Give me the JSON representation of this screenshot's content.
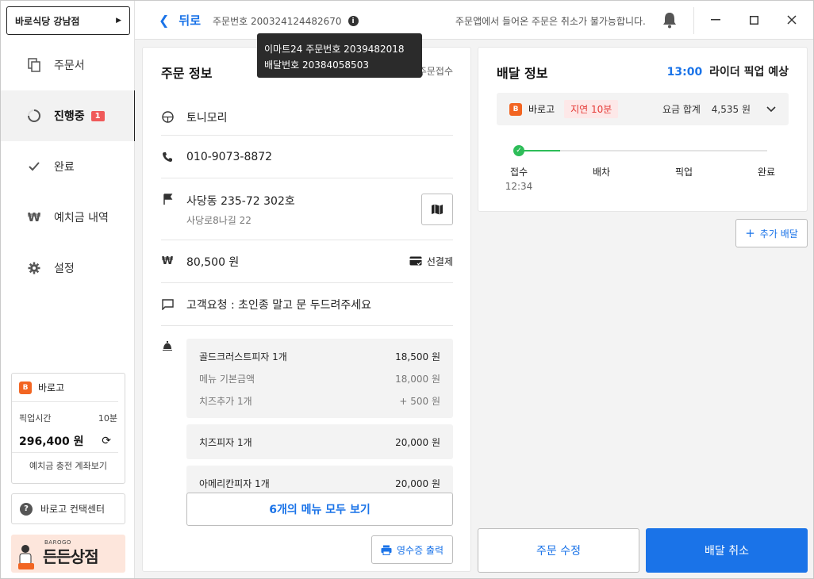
{
  "sidebar": {
    "store_name": "바로식당 강남점",
    "nav": [
      {
        "label": "주문서",
        "icon": "copy-icon"
      },
      {
        "label": "진행중",
        "icon": "progress-icon",
        "badge": "1",
        "active": true
      },
      {
        "label": "완료",
        "icon": "check-icon"
      },
      {
        "label": "예치금 내역",
        "icon": "won-icon"
      },
      {
        "label": "설정",
        "icon": "gear-icon"
      }
    ],
    "barogo_card": {
      "brand": "바로고",
      "pickup_label": "픽업시간",
      "pickup_value": "10분",
      "balance": "296,400 원",
      "link": "예치금 충전 계좌보기"
    },
    "contact_center": "바로고 컨택센터",
    "banner": {
      "tag": "BAROGO",
      "title": "든든상점"
    }
  },
  "topbar": {
    "back_label": "뒤로",
    "order_number": "주문번호 200324124482670",
    "notice": "주문앱에서 들어온 주문은 취소가 불가능합니다."
  },
  "tooltip": {
    "line1": "이마트24 주문번호 2039482018",
    "line2": "배달번호 20384058503"
  },
  "order_info": {
    "title": "주문 정보",
    "status": "주문접수",
    "store": "토니모리",
    "phone": "010-9073-8872",
    "address": "사당동 235-72 302호",
    "address_sub": "사당로8나길 22",
    "price": "80,500 원",
    "payment": "선결제",
    "request": "고객요청 : 초인종 말고 문 두드려주세요",
    "menu_items": [
      {
        "name": "골드크러스트피자 1개",
        "price": "18,500 원",
        "subs": [
          {
            "name": "메뉴 기본금액",
            "price": "18,000 원"
          },
          {
            "name": "치즈추가 1개",
            "price": "+ 500 원"
          }
        ]
      },
      {
        "name": "치즈피자 1개",
        "price": "20,000 원",
        "subs": []
      },
      {
        "name": "아메리칸피자 1개",
        "price": "20,000 원",
        "subs": []
      }
    ],
    "view_all": "6개의 메뉴 모두 보기",
    "receipt": "영수증 출력"
  },
  "delivery_info": {
    "title": "배달 정보",
    "eta_time": "13:00",
    "eta_text": "라이더 픽업 예상",
    "agency": "바로고",
    "delay": "지연 10분",
    "fee_label": "요금 합계",
    "fee_value": "4,535 원",
    "progress": 0.17,
    "steps": [
      {
        "label": "접수",
        "time": "12:34"
      },
      {
        "label": "배차",
        "time": ""
      },
      {
        "label": "픽업",
        "time": ""
      },
      {
        "label": "완료",
        "time": ""
      }
    ],
    "add_delivery": "추가 배달"
  },
  "actions": {
    "modify": "주문 수정",
    "cancel": "배달 취소"
  },
  "colors": {
    "accent": "#1a73e8",
    "progress": "#2ebd59",
    "danger": "#e53935",
    "brand_orange": "#f26522"
  }
}
